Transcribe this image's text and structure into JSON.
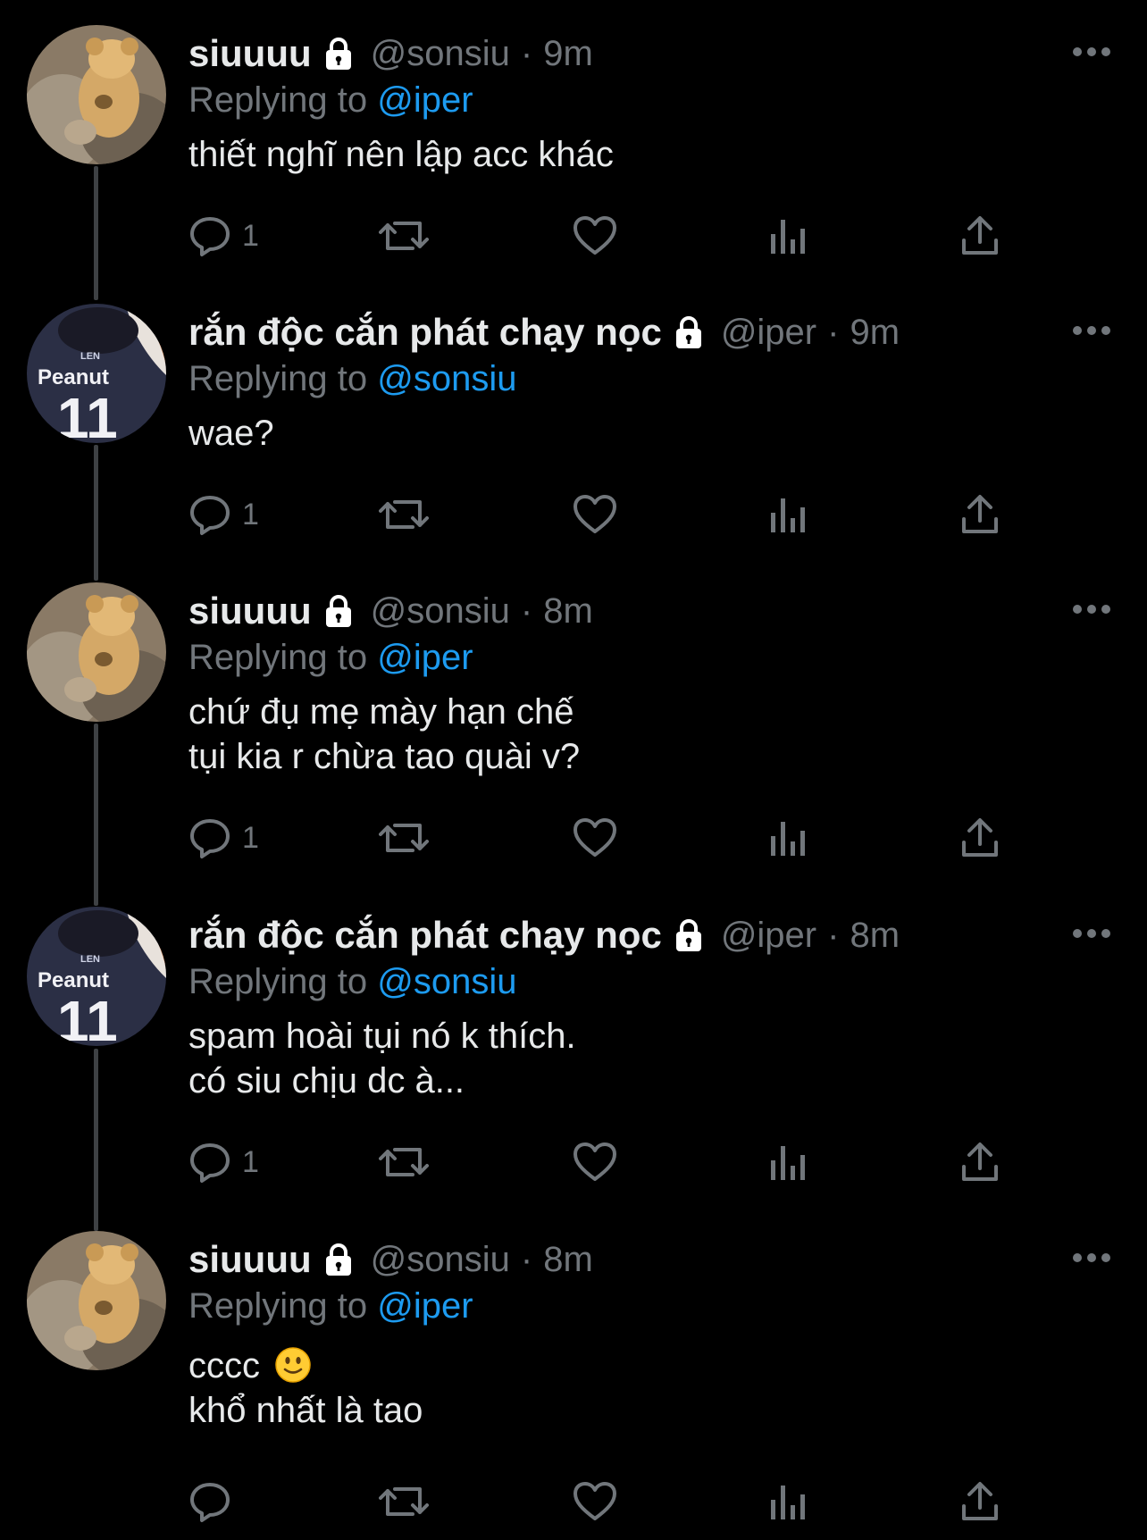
{
  "theme": {
    "background": "#000000",
    "text_primary": "#e7e9ea",
    "text_secondary": "#71767b",
    "link": "#1d9bf0",
    "thread_line": "#3e4144"
  },
  "icons": {
    "lock": "lock-icon",
    "more": "more-horizontal-icon",
    "reply": "comment-bubble-icon",
    "retweet": "retweet-arrows-icon",
    "like": "heart-icon",
    "views": "bar-chart-icon",
    "share": "share-upload-icon",
    "emoji": "slightly-smiling-face-emoji"
  },
  "tweets": [
    {
      "display_name": "siuuuu",
      "handle": "@sonsiu",
      "separator": "·",
      "time": "9m",
      "replying_prefix": "Replying to",
      "replying_to": "@iper",
      "text_lines": [
        "thiết nghĩ nên lập acc khác"
      ],
      "reply_count": "1"
    },
    {
      "display_name": "rắn độc cắn phát chạy nọc",
      "handle": "@iper",
      "separator": "·",
      "time": "9m",
      "replying_prefix": "Replying to",
      "replying_to": "@sonsiu",
      "text_lines": [
        "wae?"
      ],
      "reply_count": "1"
    },
    {
      "display_name": "siuuuu",
      "handle": "@sonsiu",
      "separator": "·",
      "time": "8m",
      "replying_prefix": "Replying to",
      "replying_to": "@iper",
      "text_lines": [
        "chứ đụ mẹ mày hạn chế",
        "tụi kia r chừa tao quài v?"
      ],
      "reply_count": "1"
    },
    {
      "display_name": "rắn độc cắn phát chạy nọc",
      "handle": "@iper",
      "separator": "·",
      "time": "8m",
      "replying_prefix": "Replying to",
      "replying_to": "@sonsiu",
      "text_lines": [
        "spam hoài tụi nó k thích.",
        "có siu chịu dc à..."
      ],
      "reply_count": "1"
    },
    {
      "display_name": "siuuuu",
      "handle": "@sonsiu",
      "separator": "·",
      "time": "8m",
      "replying_prefix": "Replying to",
      "replying_to": "@iper",
      "text_lines": [
        "cccc",
        "khổ nhất là tao"
      ],
      "reply_count": ""
    }
  ],
  "avatar_labels": {
    "jersey_name": "Peanut",
    "jersey_number": "11",
    "jersey_brand": "LEN"
  }
}
